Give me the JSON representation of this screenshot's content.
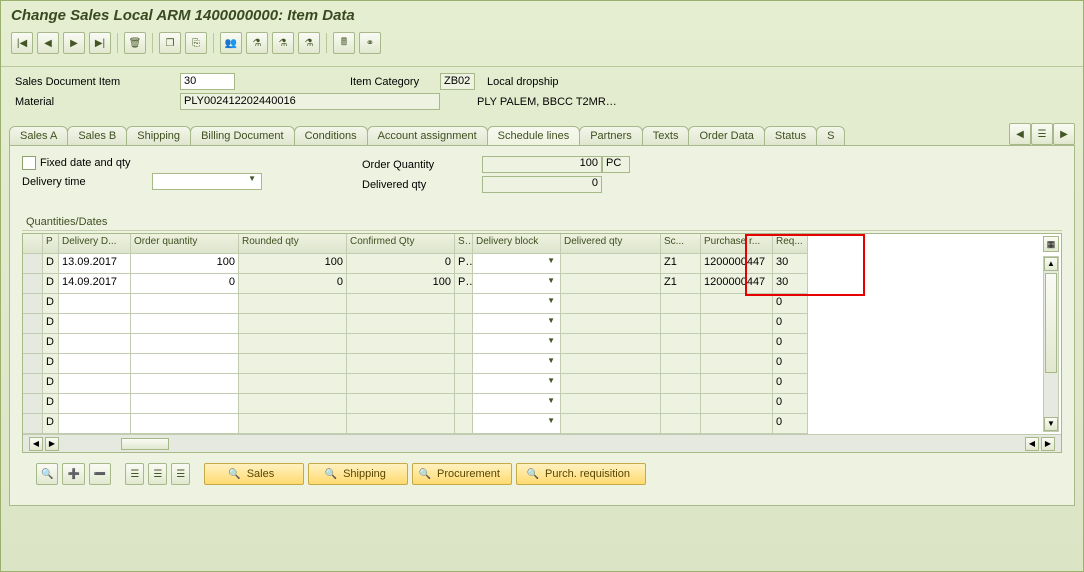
{
  "title": "Change Sales Local ARM 1400000000: Item Data",
  "header": {
    "sales_doc_item_label": "Sales Document Item",
    "sales_doc_item_value": "30",
    "item_category_label": "Item Category",
    "item_category_value": "ZB02",
    "item_category_desc": "Local dropship",
    "material_label": "Material",
    "material_value": "PLY002412202440016",
    "material_desc": "PLY PALEM, BBCC T2MR…"
  },
  "tabs": [
    "Sales A",
    "Sales B",
    "Shipping",
    "Billing Document",
    "Conditions",
    "Account assignment",
    "Schedule lines",
    "Partners",
    "Texts",
    "Order Data",
    "Status",
    "S"
  ],
  "active_tab_index": 6,
  "panel": {
    "fixed_date_label": "Fixed date and qty",
    "delivery_time_label": "Delivery time",
    "delivery_time_value": "",
    "order_qty_label": "Order Quantity",
    "order_qty_value": "100",
    "order_qty_unit": "PC",
    "delivered_qty_label": "Delivered qty",
    "delivered_qty_value": "0"
  },
  "grid": {
    "title": "Quantities/Dates",
    "columns": [
      "",
      "P",
      "Delivery D...",
      "Order quantity",
      "Rounded qty",
      "Confirmed Qty",
      "S...",
      "Delivery block",
      "Delivered qty",
      "Sc...",
      "Purchase r...",
      "Req..."
    ],
    "rows": [
      {
        "p": "D",
        "date": "13.09.2017",
        "ordqty": "100",
        "rndqty": "100",
        "confqty": "0",
        "su": "PC",
        "block": "",
        "delv": "",
        "sc": "Z1",
        "pr": "1200000447",
        "req": "30"
      },
      {
        "p": "D",
        "date": "14.09.2017",
        "ordqty": "0",
        "rndqty": "0",
        "confqty": "100",
        "su": "PC",
        "block": "",
        "delv": "",
        "sc": "Z1",
        "pr": "1200000447",
        "req": "30"
      },
      {
        "p": "D",
        "date": "",
        "ordqty": "",
        "rndqty": "",
        "confqty": "",
        "su": "",
        "block": "",
        "delv": "",
        "sc": "",
        "pr": "",
        "req": "0"
      },
      {
        "p": "D",
        "date": "",
        "ordqty": "",
        "rndqty": "",
        "confqty": "",
        "su": "",
        "block": "",
        "delv": "",
        "sc": "",
        "pr": "",
        "req": "0"
      },
      {
        "p": "D",
        "date": "",
        "ordqty": "",
        "rndqty": "",
        "confqty": "",
        "su": "",
        "block": "",
        "delv": "",
        "sc": "",
        "pr": "",
        "req": "0"
      },
      {
        "p": "D",
        "date": "",
        "ordqty": "",
        "rndqty": "",
        "confqty": "",
        "su": "",
        "block": "",
        "delv": "",
        "sc": "",
        "pr": "",
        "req": "0"
      },
      {
        "p": "D",
        "date": "",
        "ordqty": "",
        "rndqty": "",
        "confqty": "",
        "su": "",
        "block": "",
        "delv": "",
        "sc": "",
        "pr": "",
        "req": "0"
      },
      {
        "p": "D",
        "date": "",
        "ordqty": "",
        "rndqty": "",
        "confqty": "",
        "su": "",
        "block": "",
        "delv": "",
        "sc": "",
        "pr": "",
        "req": "0"
      },
      {
        "p": "D",
        "date": "",
        "ordqty": "",
        "rndqty": "",
        "confqty": "",
        "su": "",
        "block": "",
        "delv": "",
        "sc": "",
        "pr": "",
        "req": "0"
      }
    ]
  },
  "bottom": {
    "sales": "Sales",
    "shipping": "Shipping",
    "procurement": "Procurement",
    "purch_req": "Purch. requisition"
  },
  "icons": {
    "first": "|◀",
    "prev": "◀",
    "next": "▶",
    "last": "▶|",
    "trash": "🗑",
    "docs": "❐",
    "copy": "⎘",
    "people": "👥",
    "flask1": "⚗",
    "flask2": "⚗",
    "flask3": "⚗",
    "calc": "🖩",
    "link": "⚭",
    "mag": "🔍",
    "plus": "➕",
    "minus": "➖",
    "tree": "☰",
    "cfg": "▦",
    "tab_first": "◀",
    "tab_list": "☰",
    "tab_last": "▶"
  }
}
